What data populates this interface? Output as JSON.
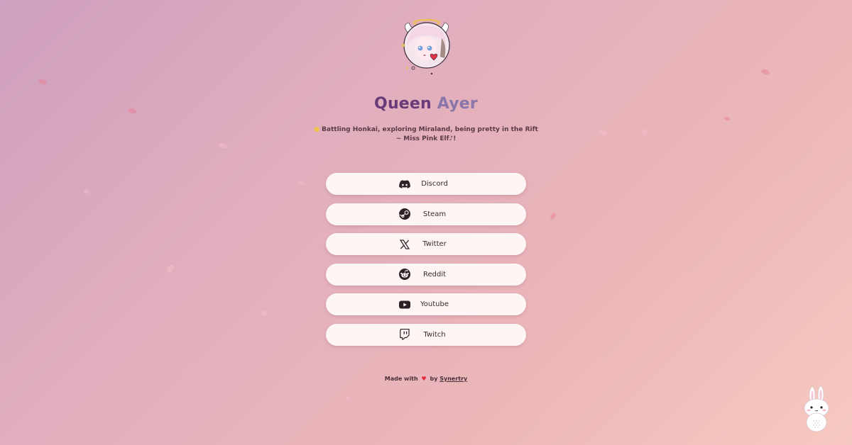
{
  "profile": {
    "name_first": "Queen",
    "name_last": "Ayer",
    "bio_line1": "Battling Honkai, exploring Miraland, being pretty in the Rift",
    "bio_line2": "~ Miss Pink Elf♪!",
    "avatar_icon": "angel-avatar-icon"
  },
  "links": [
    {
      "label": "Discord",
      "icon": "discord-icon"
    },
    {
      "label": "Steam",
      "icon": "steam-icon"
    },
    {
      "label": "Twitter",
      "icon": "x-twitter-icon"
    },
    {
      "label": "Reddit",
      "icon": "reddit-icon"
    },
    {
      "label": "Youtube",
      "icon": "youtube-icon"
    },
    {
      "label": "Twitch",
      "icon": "twitch-icon"
    }
  ],
  "footer": {
    "made_with": "Made with",
    "heart": "♥",
    "by": "by",
    "author": "Synertry"
  },
  "colors": {
    "bg_start": "#cfa0bf",
    "bg_end": "#f6c9c0",
    "name_first": "#6a3b78",
    "name_last": "#8a76a8",
    "button_bg": "#fdf6f4",
    "heart": "#e02a3a"
  }
}
